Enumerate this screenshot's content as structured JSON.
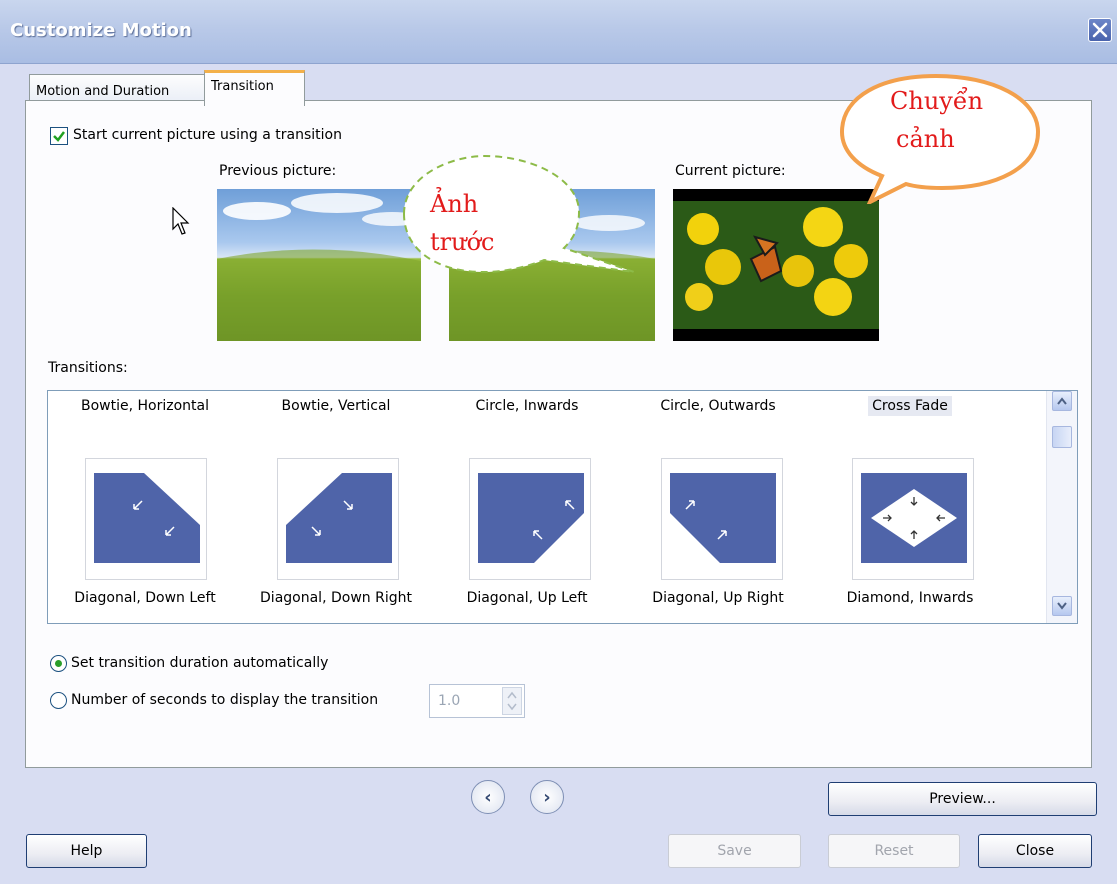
{
  "window": {
    "title": "Customize Motion",
    "close_glyph": "✕"
  },
  "tabs": [
    {
      "label": "Motion and Duration",
      "active": false
    },
    {
      "label": "Transition",
      "active": true
    }
  ],
  "transition_panel": {
    "start_checkbox": {
      "label": "Start current picture using a transition",
      "checked": true
    },
    "previous_picture_label": "Previous picture:",
    "current_picture_label": "Current picture:",
    "transitions_label": "Transitions:",
    "transitions_row1": [
      "Bowtie, Horizontal",
      "Bowtie, Vertical",
      "Circle, Inwards",
      "Circle, Outwards",
      "Cross Fade"
    ],
    "transitions_row2": [
      "Diagonal, Down Left",
      "Diagonal, Down Right",
      "Diagonal, Up Left",
      "Diagonal, Up Right",
      "Diamond, Inwards"
    ],
    "selected_transition": "Cross Fade",
    "duration_auto": {
      "label": "Set transition duration automatically",
      "selected": true
    },
    "duration_seconds": {
      "label": "Number of seconds to display the transition",
      "selected": false,
      "value": "1.0"
    }
  },
  "callouts": {
    "previous": [
      "Ảnh",
      "trước"
    ],
    "transition": [
      "Chuyển",
      "cảnh"
    ]
  },
  "buttons": {
    "back_glyph": "‹",
    "forward_glyph": "›",
    "preview": "Preview...",
    "help": "Help",
    "save": "Save",
    "reset": "Reset",
    "close": "Close"
  },
  "colors": {
    "thumb_blue": "#4f64a9",
    "callout_text": "#e21b1b",
    "callout_orange": "#f3a04c",
    "callout_green": "#8dbb48"
  }
}
